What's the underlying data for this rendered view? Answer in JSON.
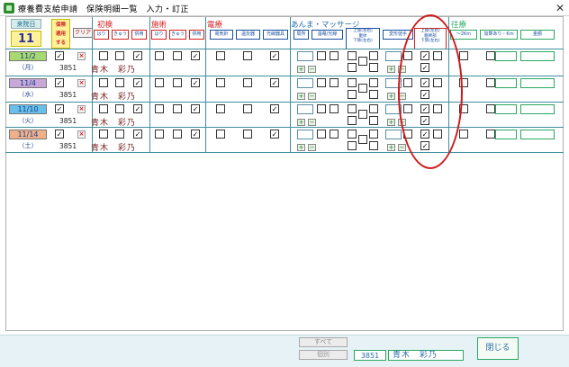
{
  "window": {
    "title": "療養費支給申請　保険明細一覧　入力・訂正",
    "close_glyph": "✕"
  },
  "visit_days": {
    "label": "来院日",
    "count": "11"
  },
  "insurance_apply": {
    "label": "保険\n適用\nする"
  },
  "clear_button": "クリア",
  "groups": {
    "first": {
      "title": "初検",
      "cols": [
        "はり",
        "きゅう",
        "併用"
      ]
    },
    "treatment": {
      "title": "施術",
      "cols": [
        "はり",
        "きゅう",
        "併用"
      ]
    },
    "electric": {
      "title": "電療",
      "cols": [
        "電気針",
        "温灸器",
        "光線器具"
      ]
    },
    "massage": {
      "title": "あんま・マッサージ",
      "cols": [
        "局所",
        "温罨/光線",
        "上肢(左右)",
        "躯体",
        "下肢(左右)",
        "変形徒手"
      ],
      "highlight_col": [
        "上肢(左右)",
        "躯幹部",
        "下肢(左右)"
      ]
    },
    "visit": {
      "title": "往療",
      "cols": [
        "～2Km",
        "加算あり・Km",
        "金額"
      ]
    }
  },
  "rows": [
    {
      "date": "11/2",
      "day": "（月）",
      "date_color": "#a8d870",
      "applied": true,
      "id": "3851",
      "name": "青木　彩乃",
      "first": [
        false,
        false,
        true
      ],
      "treat": [
        false,
        false,
        true
      ],
      "elec": [
        false,
        false,
        true
      ],
      "m_top": [
        true,
        false
      ],
      "m_bottom": [
        true
      ]
    },
    {
      "date": "11/4",
      "day": "（水）",
      "date_color": "#c8a8d8",
      "applied": true,
      "id": "3851",
      "name": "青木　彩乃",
      "first": [
        false,
        false,
        true
      ],
      "treat": [
        false,
        false,
        true
      ],
      "elec": [
        false,
        false,
        true
      ],
      "m_top": [
        true,
        false
      ],
      "m_bottom": [
        true
      ]
    },
    {
      "date": "11/10",
      "day": "（火）",
      "date_color": "#68c0e8",
      "applied": true,
      "id": "3851",
      "name": "青木　彩乃",
      "first": [
        false,
        false,
        true
      ],
      "treat": [
        false,
        false,
        true
      ],
      "elec": [
        false,
        false,
        true
      ],
      "m_top": [
        true,
        false
      ],
      "m_bottom": [
        true
      ]
    },
    {
      "date": "11/14",
      "day": "（土）",
      "date_color": "#f0b088",
      "applied": true,
      "id": "3851",
      "name": "青木　彩乃",
      "first": [
        false,
        false,
        true
      ],
      "treat": [
        false,
        false,
        true
      ],
      "elec": [
        false,
        false,
        true
      ],
      "m_top": [
        true,
        false
      ],
      "m_bottom": [
        true
      ]
    }
  ],
  "footer": {
    "all_button": "すべて",
    "each_button": "個別",
    "patient_id": "3851",
    "patient_name": "青木　彩乃",
    "close_button": "閉じる"
  },
  "colors": {
    "accent_red": "#d42020",
    "accent_green": "#2aa860",
    "highlight_oval": "#d01818"
  }
}
